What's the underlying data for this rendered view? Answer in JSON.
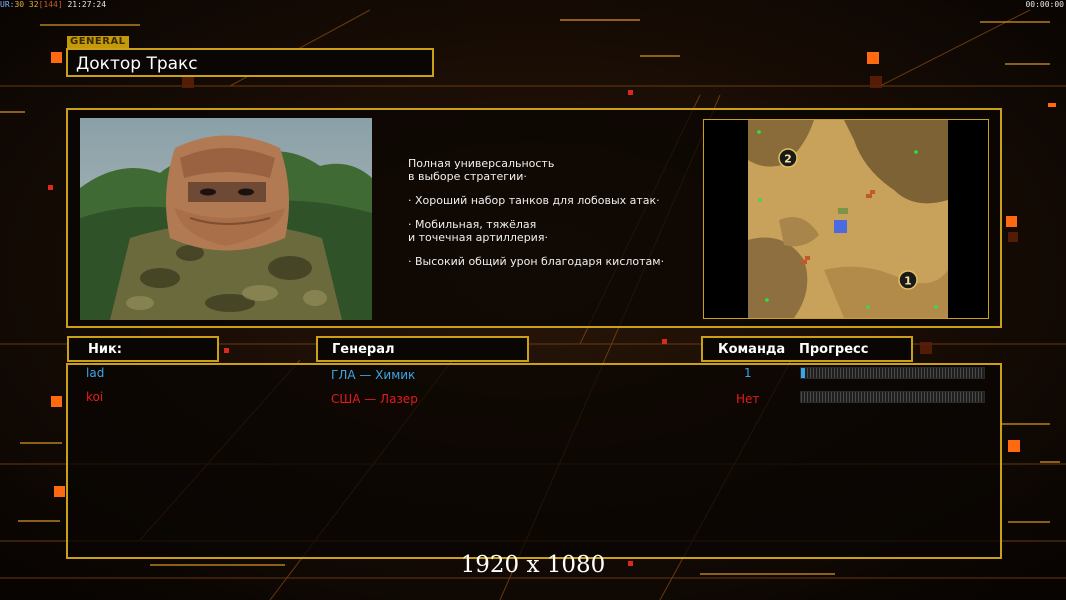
{
  "status_bar": {
    "ur_label": "UR:",
    "fps_a": "30",
    "fps_b": "32",
    "fps_c": "[144]",
    "clock": "21:27:24",
    "timer": "00:00:00"
  },
  "general": {
    "tag": "GENERAL",
    "name": "Доктор Тракс",
    "description": [
      "Полная универсальность\nв выборе стратегии·",
      "· Хороший набор танков для лобовых атак·",
      "· Мобильная, тяжёлая\nи точечная артиллерия·",
      "· Высокий общий урон благодаря кислотам·"
    ],
    "portrait_icon": "masked-soldier-portrait",
    "map_icon": "desert-minimap",
    "map_markers": [
      "1",
      "2"
    ]
  },
  "columns": {
    "nick": "Ник:",
    "general": "Генерал",
    "team": "Команда",
    "progress": "Прогресс"
  },
  "players": [
    {
      "nick": "lad",
      "general": "ГЛА — Химик",
      "team": "1",
      "color": "#3aa6e8",
      "progress": 0.02
    },
    {
      "nick": "koi",
      "general": "США — Лазер",
      "team": "Нет",
      "color": "#e51b1b",
      "progress": 0
    }
  ],
  "resolution": "1920 x 1080",
  "colors": {
    "accent": "#c9a018",
    "orange_glow": "#ff6a10"
  }
}
